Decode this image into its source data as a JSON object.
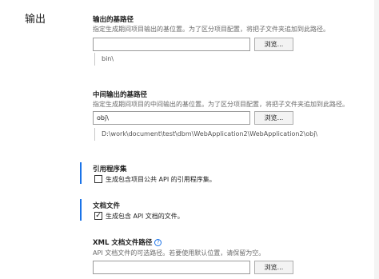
{
  "section": {
    "title": "输出"
  },
  "base_output": {
    "heading": "输出的基路径",
    "description": "指定生成期间项目输出的基位置。为了区分项目配置，将把子文件夹追加到此路径。",
    "value": "",
    "browse_label": "浏览...",
    "preview": "bin\\"
  },
  "intermediate_output": {
    "heading": "中间输出的基路径",
    "description": "指定生成期间项目的中间输出的基位置。为了区分项目配置，将把子文件夹追加到此路径。",
    "value": "obj\\",
    "browse_label": "浏览...",
    "preview": "D:\\work\\document\\test\\dbm\\WebApplication2\\WebApplication2\\obj\\"
  },
  "reference_assembly": {
    "heading": "引用程序集",
    "checkbox_label": "生成包含项目公共 API 的引用程序集。",
    "checked": false
  },
  "documentation_file": {
    "heading": "文档文件",
    "checkbox_label": "生成包含 API 文档的文件。",
    "checked": true
  },
  "xml_doc_path": {
    "heading": "XML 文档文件路径",
    "info_icon": "?",
    "description": "API 文档文件的可选路径。若要使用默认位置，请保留为空。",
    "value": "",
    "browse_label": "浏览..."
  },
  "colors": {
    "accent": "#1a73e8"
  }
}
